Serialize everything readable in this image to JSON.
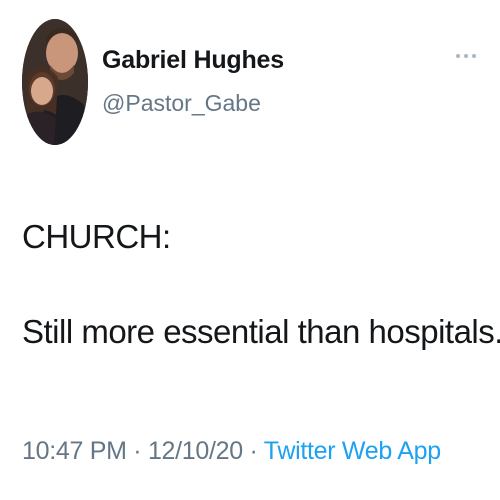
{
  "author": {
    "name": "Gabriel Hughes",
    "handle": "@Pastor_Gabe",
    "avatar_icon": "profile-photo"
  },
  "menu_icon": "more-options-icon",
  "tweet": {
    "lines": [
      "CHURCH:",
      "Still more essential than hospitals."
    ]
  },
  "meta": {
    "time": "10:47 PM",
    "separator": "·",
    "date": "12/10/20",
    "source": "Twitter Web App"
  },
  "colors": {
    "text": "#14171a",
    "secondary": "#657786",
    "link": "#1da1f2"
  }
}
